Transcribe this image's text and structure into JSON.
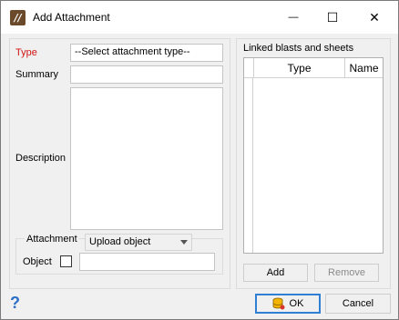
{
  "window": {
    "title": "Add Attachment",
    "minimize_glyph": "—",
    "maximize_glyph": "☐",
    "close_glyph": "✕"
  },
  "form": {
    "type_label": "Type",
    "type_value": "--Select attachment type--",
    "summary_label": "Summary",
    "summary_value": "",
    "description_label": "Description",
    "description_value": "",
    "attachment_label": "Attachment",
    "attachment_selected": "Upload object",
    "object_label": "Object",
    "object_checked": false,
    "object_value": ""
  },
  "linked": {
    "title": "Linked blasts and sheets",
    "columns": [
      "Type",
      "Name"
    ],
    "rows": [],
    "add_label": "Add",
    "remove_label": "Remove"
  },
  "footer": {
    "help_glyph": "?",
    "ok_label": "OK",
    "cancel_label": "Cancel"
  },
  "colors": {
    "required_label": "#d11414",
    "help_icon": "#2b6fc9",
    "default_button_border": "#2f7fd4"
  }
}
